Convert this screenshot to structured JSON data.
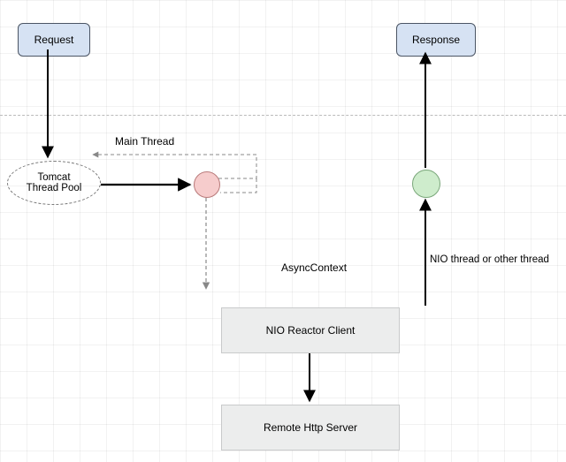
{
  "nodes": {
    "request": "Request",
    "response": "Response",
    "tomcat_pool": "Tomcat\nThread Pool",
    "nio_reactor": "NIO Reactor Client",
    "remote_server": "Remote Http Server"
  },
  "labels": {
    "main_thread": "Main Thread",
    "async_context": "AsyncContext",
    "nio_thread": "NIO thread or other thread"
  },
  "colors": {
    "request_bg": "#d6e2f3",
    "circle_red": "#f6cccc",
    "circle_green": "#ceeccc",
    "block_bg": "#eceded"
  }
}
